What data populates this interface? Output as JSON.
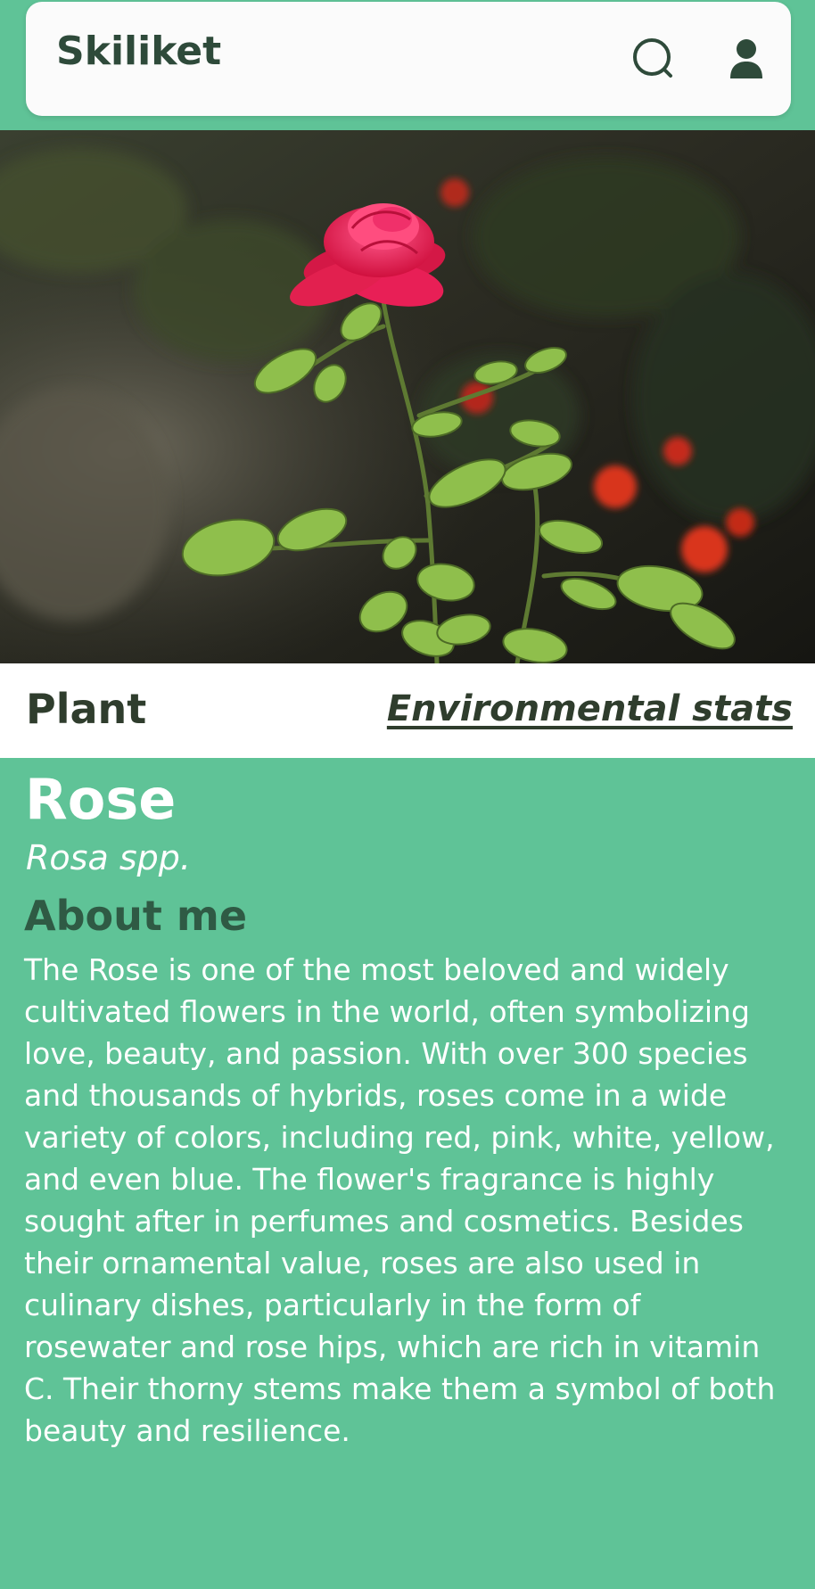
{
  "header": {
    "app_title": "Skiliket",
    "icons": [
      "search-icon",
      "user-icon"
    ]
  },
  "hero": {
    "image": "rose-photo"
  },
  "section_bar": {
    "category_label": "Plant",
    "stats_link": "Environmental  stats"
  },
  "plant": {
    "common_name": "Rose",
    "scientific_name": "Rosa spp.",
    "about_heading": "About me",
    "about_text": "The Rose is one of the most beloved and widely cultivated flowers in the world, often symbolizing love, beauty, and passion. With over 300 species and thousands of hybrids, roses come in a wide variety of colors, including red, pink, white, yellow, and even blue. The flower's fragrance is highly sought after in perfumes and cosmetics. Besides their ornamental value, roses are also used in culinary dishes, particularly in the form of rosewater and rose hips, which are rich in vitamin C. Their thorny stems make them a symbol of both beauty and resilience."
  },
  "colors": {
    "accent_green": "#5fc397",
    "header_card": "#fbfbfb",
    "dark_text": "#2f3d2d",
    "heading_green": "#2f5a44"
  }
}
